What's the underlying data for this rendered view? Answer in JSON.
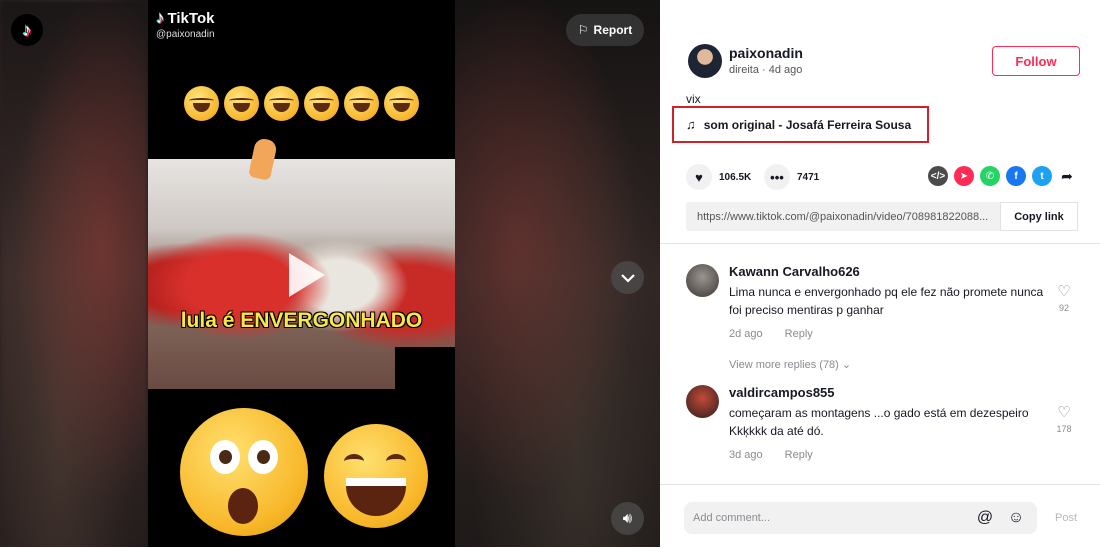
{
  "video": {
    "watermark_brand": "TikTok",
    "watermark_user": "@paixonadin",
    "caption": "lula é ENVERGONHADO",
    "report_label": "Report"
  },
  "author": {
    "name": "paixonadin",
    "sub": "direita · 4d ago",
    "follow_label": "Follow"
  },
  "post": {
    "description": "vix",
    "music": "som original - Josafá Ferreira Sousa",
    "likes": "106.5K",
    "comments": "7471",
    "link": "https://www.tiktok.com/@paixonadin/video/708981822088...",
    "copy_label": "Copy link"
  },
  "comments": [
    {
      "user": "Kawann Carvalho626",
      "text": "Lima nunca e envergonhado pq ele fez não promete nunca foi preciso mentiras p ganhar",
      "age": "2d ago",
      "reply_label": "Reply",
      "likes": "92",
      "view_more": "View more replies (78)"
    },
    {
      "user": "valdircampos855",
      "text": "começaram as montagens ...o gado está em dezespeiro Kkķkkk da até dó.",
      "age": "3d ago",
      "reply_label": "Reply",
      "likes": "178"
    }
  ],
  "composer": {
    "placeholder": "Add comment...",
    "post_label": "Post"
  },
  "colors": {
    "brand_red": "#fe2c55",
    "highlight_border": "#d0202a"
  }
}
